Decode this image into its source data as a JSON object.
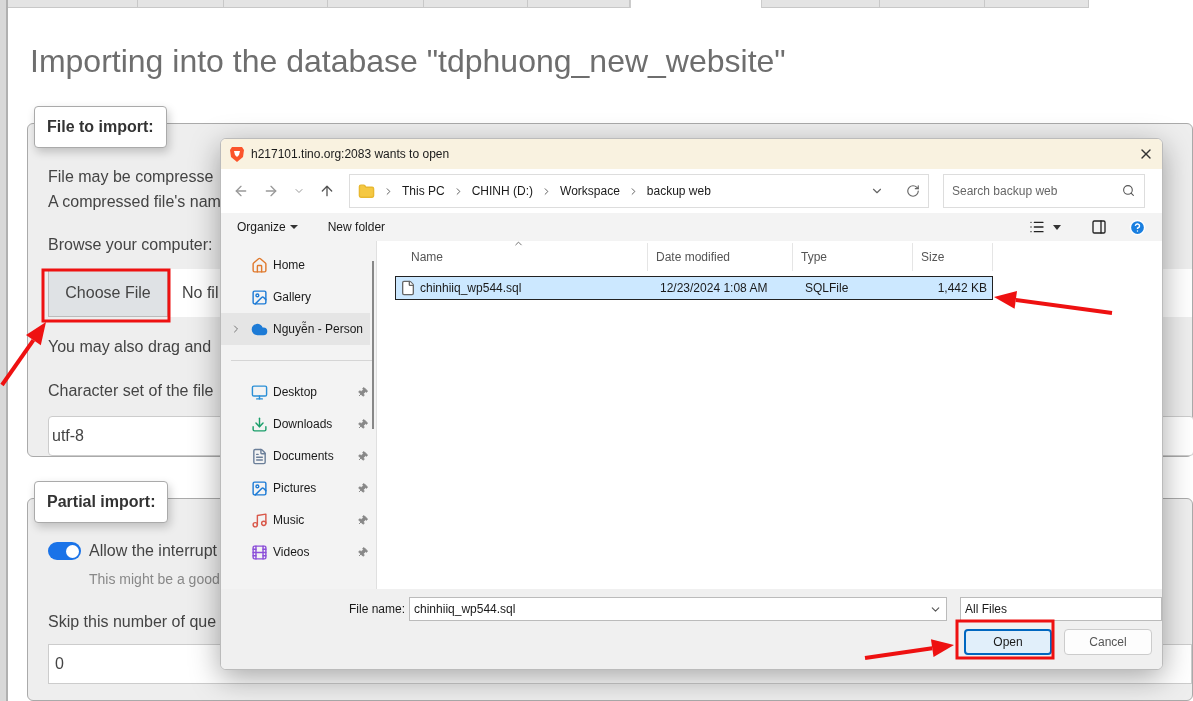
{
  "page": {
    "tabs": [
      {
        "selected": false
      },
      {
        "selected": false
      },
      {
        "selected": false
      },
      {
        "selected": false
      },
      {
        "selected": false
      },
      {
        "selected": false
      },
      {
        "selected": true
      },
      {
        "selected": false
      },
      {
        "selected": false
      },
      {
        "selected": false
      }
    ],
    "title": "Importing into the database \"tdphuong_new_website\"",
    "file_section": {
      "legend": "File to import:",
      "lines": [
        "File may be compresse",
        "A compressed file's nam"
      ],
      "browse_label": "Browse your computer:",
      "choose_button": "Choose File",
      "file_status": "No fil",
      "drag_text": "You may also drag and",
      "charset_label": "Character set of the file",
      "charset_value": "utf-8"
    },
    "partial_section": {
      "legend": "Partial import:",
      "toggle": {
        "label": "Allow the interrupt",
        "on": true
      },
      "hint": "This might be a good",
      "skip_label": "Skip this number of que",
      "skip_value": "0"
    }
  },
  "dialog": {
    "title": "h217101.tino.org:2083 wants to open",
    "breadcrumbs": [
      "This PC",
      "CHINH (D:)",
      "Workspace",
      "backup web"
    ],
    "search": {
      "placeholder": "Search backup web"
    },
    "toolbar": [
      {
        "label": "Organize",
        "kind": "menu"
      },
      {
        "label": "New folder",
        "kind": "button"
      }
    ],
    "sidebar_groups": [
      [
        {
          "label": "Home",
          "pinned": false,
          "expandable": false,
          "selected": false
        },
        {
          "label": "Gallery",
          "pinned": false,
          "expandable": false,
          "selected": false
        },
        {
          "label": "Nguyễn - Person",
          "pinned": false,
          "expandable": true,
          "selected": true
        }
      ],
      [
        {
          "label": "Desktop",
          "pinned": true,
          "expandable": false,
          "selected": false
        },
        {
          "label": "Downloads",
          "pinned": true,
          "expandable": false,
          "selected": false
        },
        {
          "label": "Documents",
          "pinned": true,
          "expandable": false,
          "selected": false
        },
        {
          "label": "Pictures",
          "pinned": true,
          "expandable": false,
          "selected": false
        },
        {
          "label": "Music",
          "pinned": true,
          "expandable": false,
          "selected": false
        },
        {
          "label": "Videos",
          "pinned": true,
          "expandable": false,
          "selected": false
        }
      ]
    ],
    "columns": [
      {
        "label": "Name",
        "sorted": true
      },
      {
        "label": "Date modified",
        "sorted": false
      },
      {
        "label": "Type",
        "sorted": false
      },
      {
        "label": "Size",
        "sorted": false
      }
    ],
    "rows": [
      {
        "name": "chinhiiq_wp544.sql",
        "date": "12/23/2024 1:08 AM",
        "type": "SQLFile",
        "size": "1,442 KB",
        "selected": true
      }
    ],
    "footer": {
      "file_name_label": "File name:",
      "file_name_value": "chinhiiq_wp544.sql",
      "filter": "All Files",
      "buttons": [
        {
          "label": "Open",
          "default": true
        },
        {
          "label": "Cancel",
          "default": false
        }
      ]
    }
  }
}
